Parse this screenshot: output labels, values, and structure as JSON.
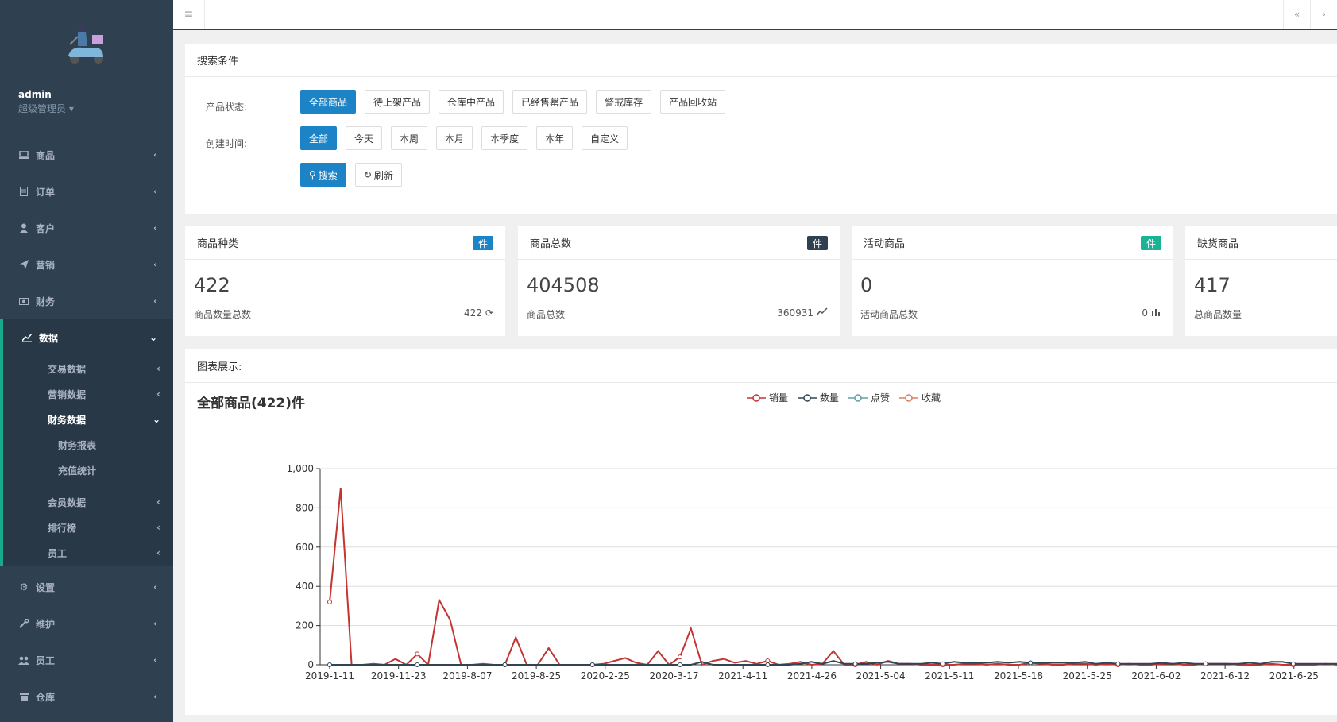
{
  "sidebar": {
    "user": "admin",
    "role": "超级管理员",
    "items": [
      {
        "label": "商品",
        "icon": "laptop-icon"
      },
      {
        "label": "订单",
        "icon": "list-icon"
      },
      {
        "label": "客户",
        "icon": "user-icon"
      },
      {
        "label": "营销",
        "icon": "paper-plane-icon"
      },
      {
        "label": "财务",
        "icon": "money-icon"
      },
      {
        "label": "数据",
        "icon": "line-chart-icon"
      }
    ],
    "data_sub": [
      "交易数据",
      "营销数据",
      "财务数据"
    ],
    "finance_sub": [
      "财务报表",
      "充值统计"
    ],
    "data_sub2": [
      "会员数据",
      "排行榜",
      "员工"
    ],
    "items_bottom": [
      {
        "label": "设置",
        "icon": "gear-icon"
      },
      {
        "label": "维护",
        "icon": "wrench-icon"
      },
      {
        "label": "员工",
        "icon": "users-icon"
      },
      {
        "label": "仓库",
        "icon": "archive-icon"
      }
    ]
  },
  "search": {
    "title": "搜索条件",
    "status_label": "产品状态:",
    "status_buttons": [
      "全部商品",
      "待上架产品",
      "仓库中产品",
      "已经售罄产品",
      "警戒库存",
      "产品回收站"
    ],
    "time_label": "创建时间:",
    "time_buttons": [
      "全部",
      "今天",
      "本周",
      "本月",
      "本季度",
      "本年",
      "自定义"
    ],
    "search_btn": "搜索",
    "refresh_btn": "刷新"
  },
  "stats": [
    {
      "title": "商品种类",
      "badge": "件",
      "badge_color": "#1c84c6",
      "value": "422",
      "sub": "商品数量总数",
      "right": "422",
      "right_icon": "refresh-icon"
    },
    {
      "title": "商品总数",
      "badge": "件",
      "badge_color": "#2f4050",
      "value": "404508",
      "sub": "商品总数",
      "right": "360931",
      "right_icon": "line-chart-icon"
    },
    {
      "title": "活动商品",
      "badge": "件",
      "badge_color": "#1ab394",
      "value": "0",
      "sub": "活动商品总数",
      "right": "0",
      "right_icon": "bar-chart-icon"
    },
    {
      "title": "缺货商品",
      "value": "417",
      "sub": "总商品数量"
    }
  ],
  "chart_panel": {
    "title": "图表展示:",
    "chart_title": "全部商品(422)件"
  },
  "chart_data": {
    "type": "line",
    "title": "全部商品(422)件",
    "legend_position": "top",
    "ylim": [
      0,
      1000
    ],
    "y_ticks": [
      "0",
      "200",
      "400",
      "600",
      "800",
      "1,000"
    ],
    "x_ticks": [
      "2019-1-11",
      "2019-11-23",
      "2019-8-07",
      "2019-8-25",
      "2020-2-25",
      "2020-3-17",
      "2021-4-11",
      "2021-4-26",
      "2021-5-04",
      "2021-5-11",
      "2021-5-18",
      "2021-5-25",
      "2021-6-02",
      "2021-6-12",
      "2021-6-25"
    ],
    "series": [
      {
        "name": "销量",
        "color": "#c23531",
        "values": [
          320,
          900,
          0,
          0,
          5,
          0,
          30,
          0,
          55,
          0,
          330,
          230,
          0,
          0,
          5,
          0,
          0,
          140,
          0,
          0,
          85,
          0,
          0,
          0,
          0,
          5,
          20,
          35,
          10,
          0,
          70,
          0,
          40,
          185,
          0,
          20,
          30,
          10,
          20,
          5,
          20,
          0,
          5,
          15,
          0,
          5,
          70,
          0,
          0,
          15,
          0,
          20,
          5,
          5,
          0,
          0,
          0,
          0,
          5,
          5,
          0,
          5,
          0,
          0,
          10,
          5,
          0,
          0,
          5,
          5,
          0,
          5,
          0,
          5,
          0,
          0,
          5,
          5,
          0,
          0,
          5,
          5,
          5,
          0,
          0,
          0,
          5,
          0,
          0,
          0,
          0,
          5,
          0
        ]
      },
      {
        "name": "数量",
        "color": "#2f4554",
        "values": [
          0,
          0,
          0,
          0,
          0,
          0,
          0,
          0,
          0,
          0,
          0,
          0,
          0,
          0,
          0,
          0,
          0,
          0,
          0,
          0,
          0,
          0,
          0,
          0,
          0,
          0,
          0,
          0,
          0,
          0,
          0,
          0,
          0,
          0,
          15,
          0,
          0,
          0,
          0,
          0,
          0,
          0,
          0,
          5,
          15,
          5,
          20,
          5,
          5,
          5,
          10,
          15,
          5,
          5,
          5,
          10,
          5,
          15,
          10,
          10,
          10,
          15,
          10,
          15,
          10,
          10,
          10,
          10,
          10,
          15,
          5,
          10,
          5,
          5,
          5,
          5,
          10,
          5,
          10,
          5,
          5,
          5,
          5,
          5,
          10,
          5,
          15,
          15,
          5,
          5,
          5,
          5,
          5
        ]
      },
      {
        "name": "点赞",
        "color": "#61a0a8",
        "values": []
      },
      {
        "name": "收藏",
        "color": "#d48265",
        "values": []
      }
    ]
  },
  "colors": {
    "sidebar_bg": "#2f4050",
    "primary": "#1c84c6",
    "accent": "#19aa8d"
  }
}
